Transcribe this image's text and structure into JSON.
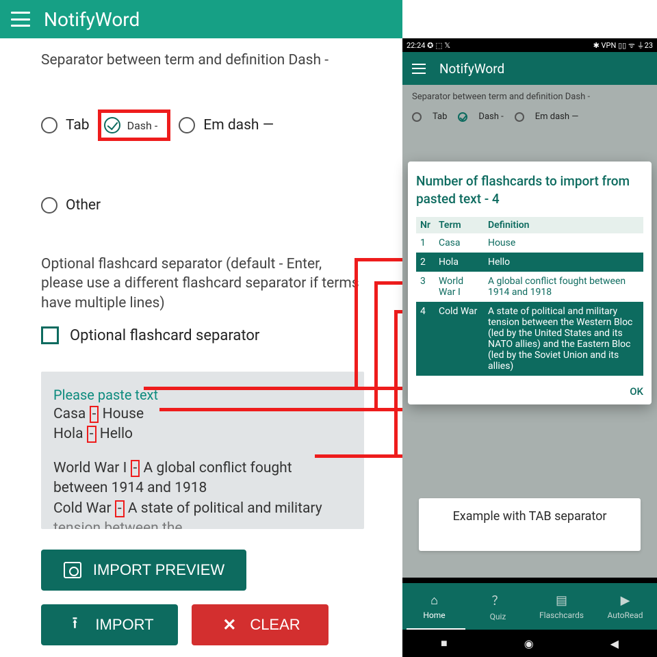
{
  "app": {
    "title": "NotifyWord"
  },
  "left": {
    "separator_label": "Separator between term and definition Dash -",
    "radios": {
      "tab": "Tab",
      "dash": "Dash -",
      "emdash": "Em dash —",
      "other": "Other"
    },
    "optional_info": "Optional flashcard separator (default - Enter, please use a different flashcard separator if terms have multiple lines)",
    "optional_checkbox_label": "Optional flashcard separator",
    "paste": {
      "placeholder": "Please paste text",
      "line1a": "Casa ",
      "line1b": " House",
      "line2a": "Hola ",
      "line2b": " Hello",
      "line3a": "World War I ",
      "line3b": " A global conflict fought",
      "line3c": "between 1914 and 1918",
      "line4a": "Cold War ",
      "line4b": " A state of political and military",
      "line4c": "tension between the"
    },
    "dash_char": "-",
    "buttons": {
      "preview": "IMPORT PREVIEW",
      "import": "IMPORT",
      "clear": "CLEAR"
    }
  },
  "phone": {
    "status": {
      "time": "22:24",
      "icons_left": "✪ ⬚ 𝕏",
      "icons_right": "✱ VPN ▯▯ ᯤ ⏚23"
    },
    "title": "NotifyWord",
    "bg_label": "Separator between term and definition Dash -",
    "radios": {
      "tab": "Tab",
      "dash": "Dash -",
      "emdash": "Em dash —"
    },
    "dialog": {
      "title": "Number of flashcards to import from pasted text - 4",
      "headers": {
        "nr": "Nr",
        "term": "Term",
        "def": "Definition"
      },
      "rows": [
        {
          "nr": "1",
          "term": "Casa",
          "def": "House"
        },
        {
          "nr": "2",
          "term": "Hola",
          "def": "Hello"
        },
        {
          "nr": "3",
          "term": "World War I",
          "def": "A global conflict fought between 1914 and 1918"
        },
        {
          "nr": "4",
          "term": "Cold War",
          "def": "A state of political and military tension between the Western Bloc (led by the United States and its NATO allies) and the Eastern Bloc (led by the Soviet Union and its allies)"
        }
      ],
      "ok": "OK"
    },
    "example_card": "Example with TAB separator",
    "nav": {
      "home": "Home",
      "quiz": "Quiz",
      "flash": "Flaschcards",
      "auto": "AutoRead"
    }
  }
}
